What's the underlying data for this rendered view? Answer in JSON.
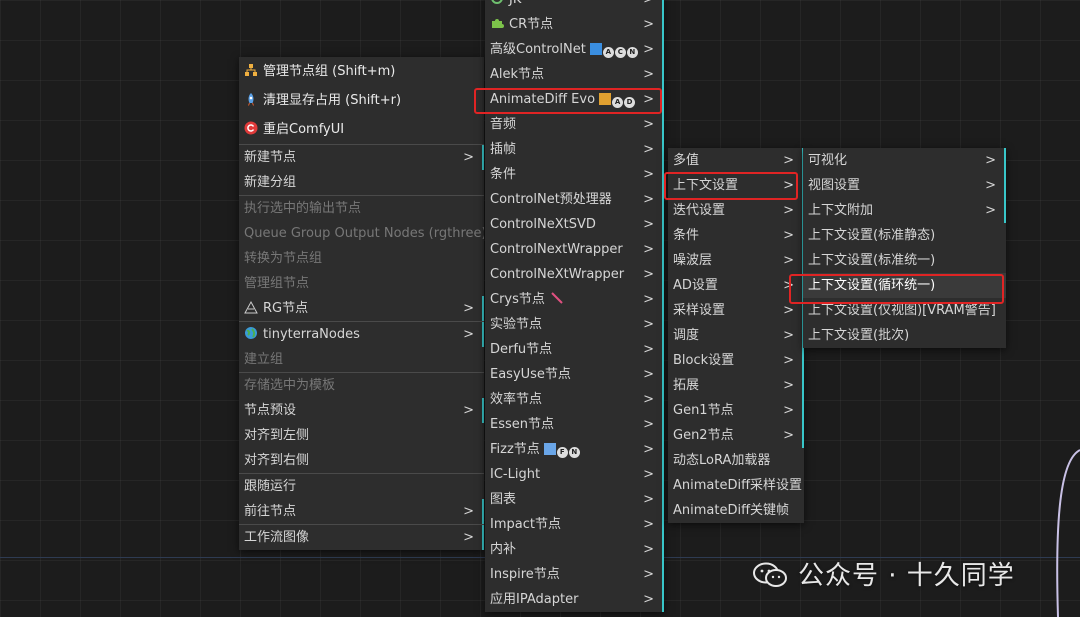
{
  "main_menu": {
    "items": [
      {
        "label": "管理节点组 (Shift+m)",
        "icon": "node-group-icon"
      },
      {
        "label": "清理显存占用 (Shift+r)",
        "icon": "rocket-icon"
      },
      {
        "label": "重启ComfyUI",
        "icon": "restart-icon"
      },
      {
        "label": "新建节点"
      },
      {
        "label": "新建分组"
      },
      {
        "label": "执行选中的输出节点"
      },
      {
        "label": "Queue Group Output Nodes (rgthree)"
      },
      {
        "label": "转换为节点组"
      },
      {
        "label": "管理组节点"
      },
      {
        "label": "RG节点",
        "icon": "rg-icon"
      },
      {
        "label": "tinyterraNodes",
        "icon": "globe-icon"
      },
      {
        "label": "建立组"
      },
      {
        "label": "存储选中为模板"
      },
      {
        "label": "节点预设"
      },
      {
        "label": "对齐到左侧"
      },
      {
        "label": "对齐到右侧"
      },
      {
        "label": "跟随运行"
      },
      {
        "label": "前往节点"
      },
      {
        "label": "工作流图像"
      }
    ]
  },
  "category_menu": {
    "items": [
      {
        "label": "JK"
      },
      {
        "label": "CR节点"
      },
      {
        "label": "高级ControlNet"
      },
      {
        "label": "Alek节点"
      },
      {
        "label": "AnimateDiff Evo"
      },
      {
        "label": "音频"
      },
      {
        "label": "插帧"
      },
      {
        "label": "条件"
      },
      {
        "label": "ControlNet预处理器"
      },
      {
        "label": "ControlNeXtSVD"
      },
      {
        "label": "ControlNextWrapper"
      },
      {
        "label": "ControlNeXtWrapper"
      },
      {
        "label": "Crys节点"
      },
      {
        "label": "实验节点"
      },
      {
        "label": "Derfu节点"
      },
      {
        "label": "EasyUse节点"
      },
      {
        "label": "效率节点"
      },
      {
        "label": "Essen节点"
      },
      {
        "label": "Fizz节点"
      },
      {
        "label": "IC-Light"
      },
      {
        "label": "图表"
      },
      {
        "label": "Impact节点"
      },
      {
        "label": "内补"
      },
      {
        "label": "Inspire节点"
      },
      {
        "label": "应用IPAdapter"
      }
    ]
  },
  "animatediff_menu": {
    "items": [
      {
        "label": "多值"
      },
      {
        "label": "上下文设置"
      },
      {
        "label": "迭代设置"
      },
      {
        "label": "条件"
      },
      {
        "label": "噪波层"
      },
      {
        "label": "AD设置"
      },
      {
        "label": "采样设置"
      },
      {
        "label": "调度"
      },
      {
        "label": "Block设置"
      },
      {
        "label": "拓展"
      },
      {
        "label": "Gen1节点"
      },
      {
        "label": "Gen2节点"
      },
      {
        "label": "动态LoRA加载器"
      },
      {
        "label": "AnimateDiff采样设置"
      },
      {
        "label": "AnimateDiff关键帧"
      }
    ]
  },
  "context_menu": {
    "items": [
      {
        "label": "可视化"
      },
      {
        "label": "视图设置"
      },
      {
        "label": "上下文附加"
      },
      {
        "label": "上下文设置(标准静态)"
      },
      {
        "label": "上下文设置(标准统一)"
      },
      {
        "label": "上下文设置(循环统一)"
      },
      {
        "label": "上下文设置(仅视图)[VRAM警告]"
      },
      {
        "label": "上下文设置(批次)"
      }
    ]
  },
  "submenu_arrow": ">",
  "watermark": {
    "text": "公众号 · 十久同学",
    "icon": "wechat-icon"
  },
  "colors": {
    "accent": "#38c6c9",
    "highlight": "#e02424",
    "menu_bg": "#2d2d2d"
  }
}
